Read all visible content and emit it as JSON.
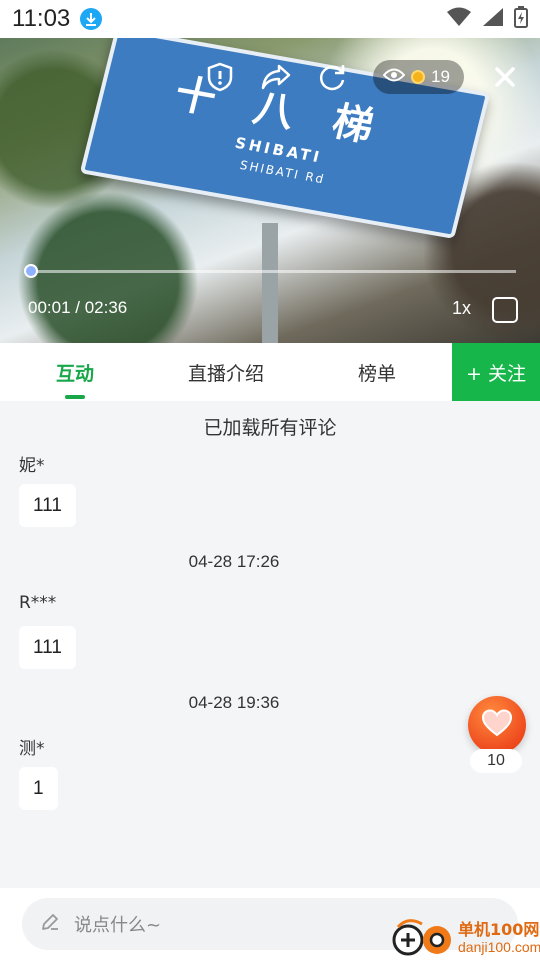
{
  "status_bar": {
    "time": "11:03"
  },
  "video": {
    "sign_title": "十八梯",
    "sign_en": "SHIBATI",
    "sign_en_sub": "SHIBATI Rd",
    "viewer_count": "19",
    "current_time": "00:01",
    "duration": "02:36",
    "time_separator": " / ",
    "playback_progress": 0.0064,
    "speed": "1x"
  },
  "tabs": [
    {
      "label": "互动"
    },
    {
      "label": "直播介绍"
    },
    {
      "label": "榜单"
    }
  ],
  "follow_label": "+ 关注",
  "comments": {
    "loaded_note": "已加载所有评论",
    "items": [
      {
        "name": "妮*",
        "text": "111"
      },
      {
        "time": "04-28 17:26",
        "name": "R***",
        "text": "111"
      },
      {
        "time": "04-28 19:36",
        "name": "测*",
        "text": "1"
      }
    ]
  },
  "like_count": "10",
  "input": {
    "placeholder": "说点什么~"
  },
  "watermark": {
    "cn": "单机100网",
    "en": "danji100.com"
  },
  "colors": {
    "accent": "#16b64b",
    "like": "#ee4a1e",
    "progress": "#7fa6ff"
  }
}
